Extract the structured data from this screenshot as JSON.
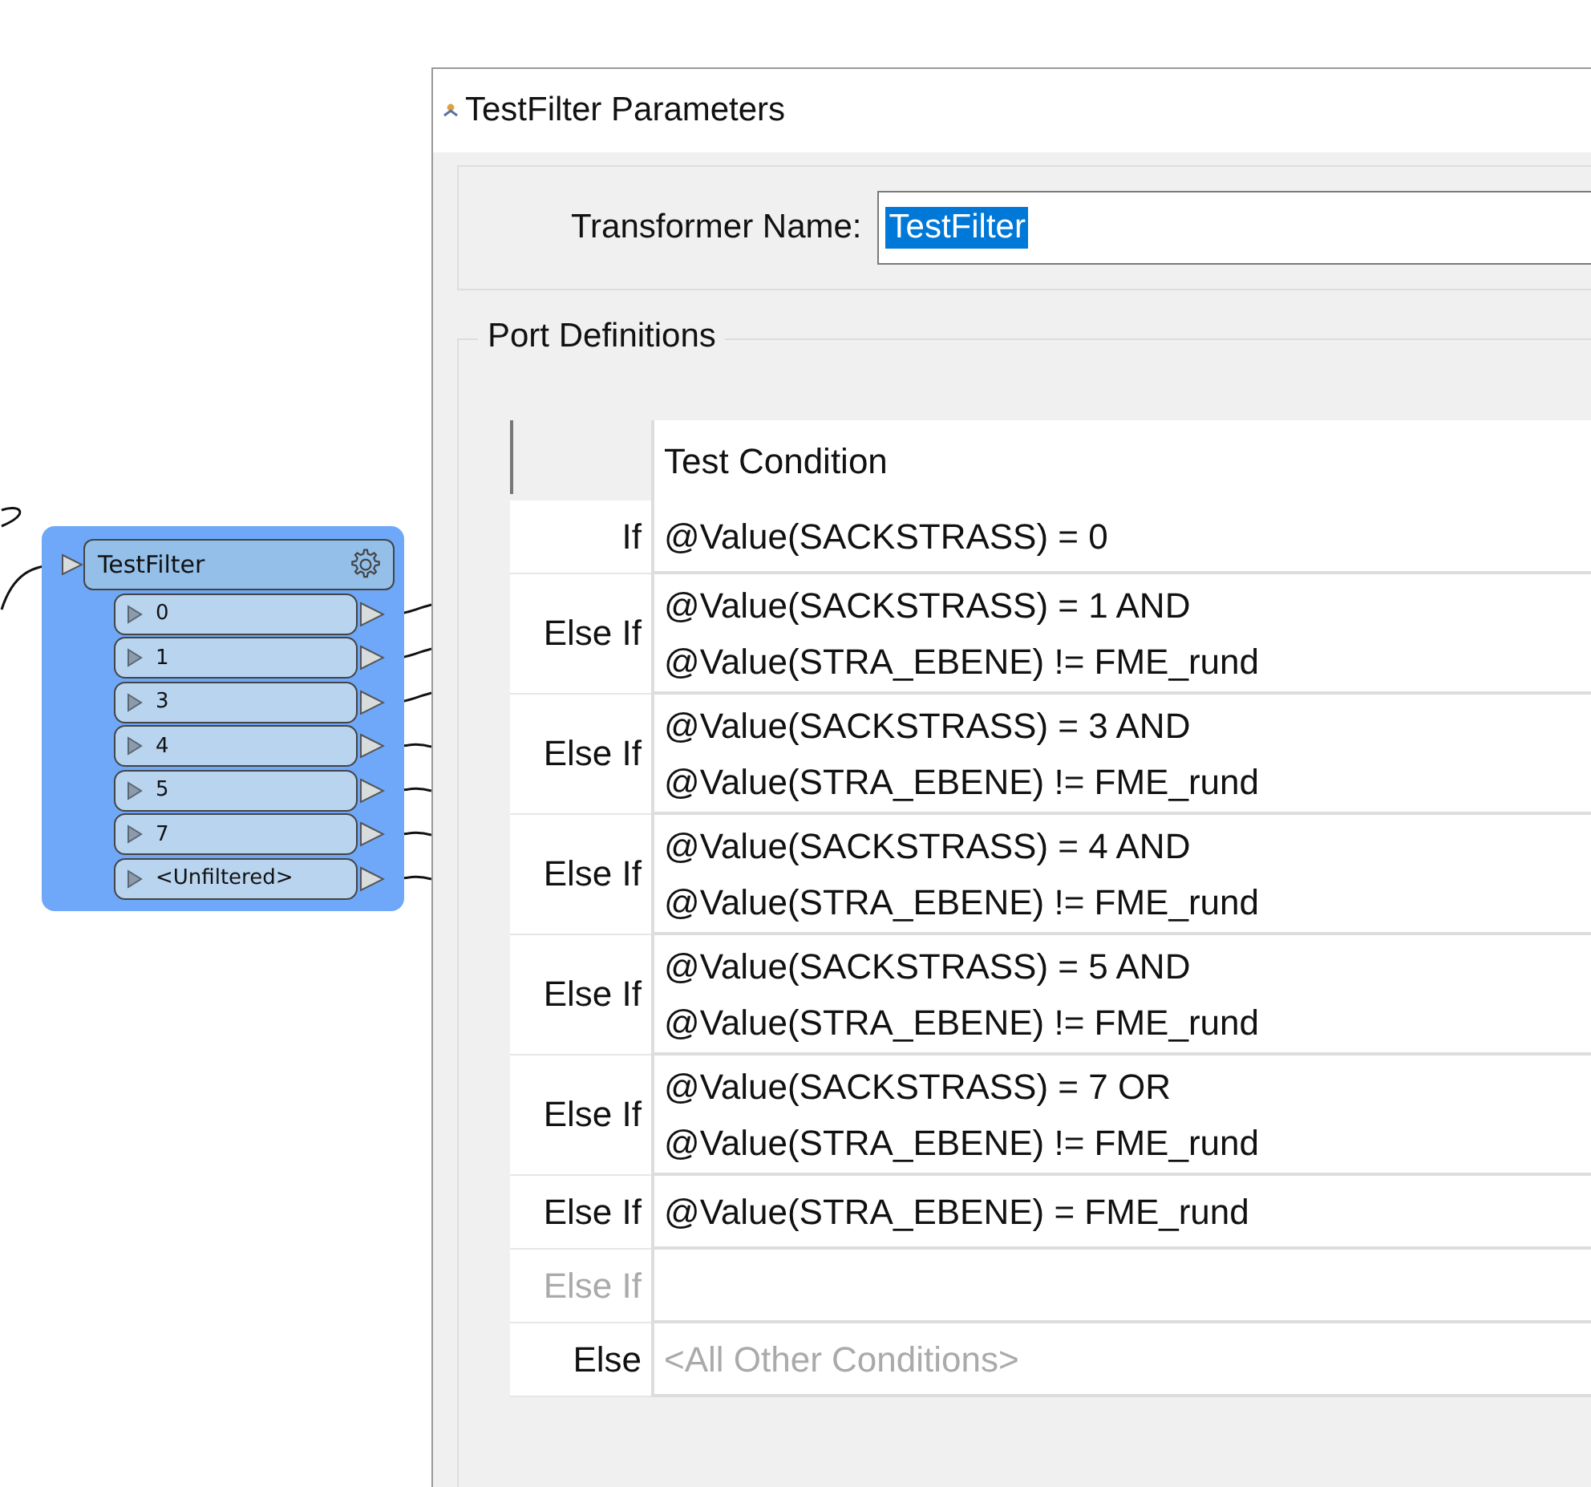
{
  "node": {
    "title": "TestFilter",
    "ports": [
      "0",
      "1",
      "3",
      "4",
      "5",
      "7",
      "<Unfiltered>"
    ]
  },
  "dialog": {
    "title": "TestFilter Parameters",
    "name_label": "Transformer Name:",
    "name_value": "TestFilter",
    "group_title": "Port Definitions",
    "column_header": "Test Condition",
    "rows": [
      {
        "kind": "if",
        "label": "If",
        "lines": [
          "@Value(SACKSTRASS) = 0"
        ],
        "disabled": false
      },
      {
        "kind": "else_if",
        "label": "Else If",
        "lines": [
          "@Value(SACKSTRASS) = 1 AND",
          "@Value(STRA_EBENE) != FME_rund"
        ],
        "disabled": false
      },
      {
        "kind": "else_if",
        "label": "Else If",
        "lines": [
          "@Value(SACKSTRASS) = 3 AND",
          "@Value(STRA_EBENE) != FME_rund"
        ],
        "disabled": false
      },
      {
        "kind": "else_if",
        "label": "Else If",
        "lines": [
          "@Value(SACKSTRASS) = 4 AND",
          "@Value(STRA_EBENE) != FME_rund"
        ],
        "disabled": false
      },
      {
        "kind": "else_if",
        "label": "Else If",
        "lines": [
          "@Value(SACKSTRASS) = 5 AND",
          "@Value(STRA_EBENE) != FME_rund"
        ],
        "disabled": false
      },
      {
        "kind": "else_if",
        "label": "Else If",
        "lines": [
          "@Value(SACKSTRASS) = 7 OR",
          "@Value(STRA_EBENE) != FME_rund"
        ],
        "disabled": false
      },
      {
        "kind": "else_if",
        "label": "Else If",
        "lines": [
          "@Value(STRA_EBENE) = FME_rund"
        ],
        "disabled": false
      },
      {
        "kind": "else_if",
        "label": "Else If",
        "lines": [],
        "disabled": true
      },
      {
        "kind": "else",
        "label": "Else",
        "placeholder": "<All Other Conditions>",
        "disabled": false
      }
    ]
  }
}
